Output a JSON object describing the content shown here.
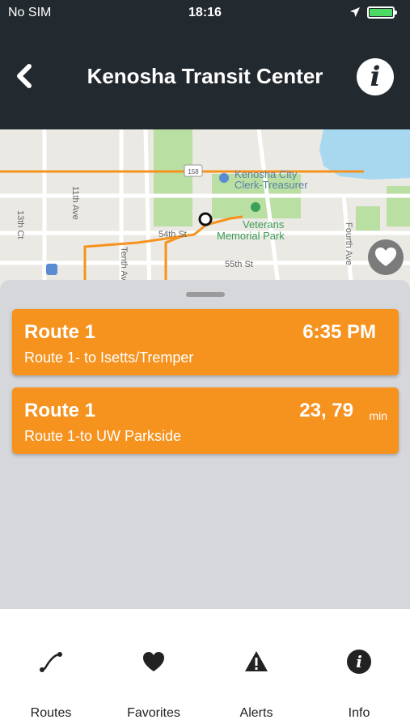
{
  "status_bar": {
    "carrier": "No SIM",
    "time": "18:16",
    "battery_color": "#4cd964"
  },
  "nav": {
    "title": "Kenosha Transit Center",
    "back_icon": "chevron-left-icon",
    "info_icon": "info-icon",
    "info_glyph": "i"
  },
  "map": {
    "labels": {
      "clerk": "Kenosha City",
      "clerk2": "Clerk-Treasurer",
      "park": "Veterans",
      "park2": "Memorial Park",
      "st54": "54th St",
      "st55": "55th St",
      "ave11": "11th Ave",
      "ave10": "Tenth Ave",
      "ct13": "13th Ct",
      "ave4": "Fourth Ave",
      "shield": "158"
    },
    "route_color": "#f6921e",
    "water_color": "#a8d8f0",
    "park_color": "#b9dfa3"
  },
  "sheet": {
    "arrivals": [
      {
        "route": "Route 1",
        "destination": "Route 1- to Isetts/Tremper",
        "time": "6:35 PM",
        "unit": ""
      },
      {
        "route": "Route 1",
        "destination": "Route 1-to UW Parkside",
        "time": "23, 79",
        "unit": "min"
      }
    ],
    "card_color": "#f6921e"
  },
  "tabs": [
    {
      "label": "Routes",
      "icon": "routes-icon"
    },
    {
      "label": "Favorites",
      "icon": "heart-icon"
    },
    {
      "label": "Alerts",
      "icon": "alert-icon"
    },
    {
      "label": "Info",
      "icon": "info-icon",
      "glyph": "i"
    }
  ]
}
